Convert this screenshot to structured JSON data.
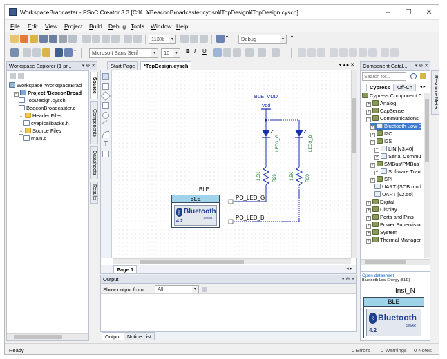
{
  "window": {
    "title": "WorkspaceBradcaster - PSoC Creator 3.3  [C:¥...¥BeaconBroadcaster.cydsn¥TopDesign¥TopDesign.cysch]",
    "minimize": "–",
    "maximize": "☐",
    "close": "✕"
  },
  "menu": [
    "File",
    "Edit",
    "View",
    "Project",
    "Build",
    "Debug",
    "Tools",
    "Window",
    "Help"
  ],
  "toolbar1": {
    "zoom_value": "113%",
    "config_value": "Debug"
  },
  "toolbar2": {
    "font_value": "Microsoft Sans Serif",
    "size_value": "10"
  },
  "workspace_explorer": {
    "title": "Workspace Explorer (1 pr...",
    "controls": "▾ ⊕ ✕",
    "items": [
      {
        "label": "Workspace 'WorkspaceBrad",
        "indent": 0,
        "icon": "ws"
      },
      {
        "label": "Project 'BeaconBroad",
        "indent": 1,
        "icon": "proj",
        "bold": true,
        "expander": "−"
      },
      {
        "label": "TopDesign.cysch",
        "indent": 2,
        "icon": "file"
      },
      {
        "label": "BeaconBroadcaster.c",
        "indent": 2,
        "icon": "file"
      },
      {
        "label": "Header Files",
        "indent": 2,
        "icon": "folder",
        "expander": "−"
      },
      {
        "label": "cyapicallbacks.h",
        "indent": 3,
        "icon": "file"
      },
      {
        "label": "Source Files",
        "indent": 2,
        "icon": "folder",
        "expander": "−"
      },
      {
        "label": "main.c",
        "indent": 3,
        "icon": "file"
      }
    ],
    "side_tabs": [
      "Source",
      "Components",
      "Datasheets",
      "Results"
    ]
  },
  "document": {
    "tabs": [
      {
        "label": "Start Page",
        "active": false
      },
      {
        "label": "*TopDesign.cysch",
        "active": true
      }
    ],
    "tab_controls": "▾ ◂ ▸ ✕",
    "page_tab": "Page 1",
    "schematic": {
      "power_label": "BLE_VDD",
      "vdd_label": "Vdd",
      "led1": "LED3_G",
      "led2": "LED3_B",
      "r1_value": "1.5K",
      "r1_name": "R29",
      "r2_value": "1.5K",
      "r2_name": "R30",
      "ble_instance": "BLE",
      "ble_block_title": "BLE",
      "ble_brand": "Bluetooth",
      "ble_smart": "SMART",
      "ble_version": "4.2",
      "pin1": "PO_LED_G",
      "pin2": "PO_LED_B"
    }
  },
  "output": {
    "title": "Output",
    "controls": "▾ ⊕ ✕",
    "show_from_label": "Show output from:",
    "show_from_value": "All",
    "tabs": [
      "Output",
      "Notice List"
    ]
  },
  "catalog": {
    "title": "Component Catal...",
    "controls": "▾ ⊕ ✕",
    "search_placeholder": "Search for...",
    "tabs": [
      "Cypress",
      "Off-Ch"
    ],
    "items": [
      {
        "label": "Cypress Component Ca",
        "indent": 0,
        "icon": "catfold"
      },
      {
        "label": "Analog",
        "indent": 1,
        "icon": "catfold",
        "expander": "+"
      },
      {
        "label": "CapSense",
        "indent": 1,
        "icon": "catfold",
        "expander": "+"
      },
      {
        "label": "Communications",
        "indent": 1,
        "icon": "catfold",
        "expander": "−"
      },
      {
        "label": "Bluetooth Low E",
        "indent": 2,
        "icon": "comp",
        "expander": "+",
        "selected": true
      },
      {
        "label": "I2C",
        "indent": 2,
        "icon": "catfold",
        "expander": "+"
      },
      {
        "label": "I2S",
        "indent": 2,
        "icon": "catfold",
        "expander": "−"
      },
      {
        "label": "LIN [v3.40]",
        "indent": 3,
        "icon": "comp",
        "expander": "+"
      },
      {
        "label": "Serial Communi",
        "indent": 3,
        "icon": "comp",
        "expander": "+"
      },
      {
        "label": "SMBus/PMBus S",
        "indent": 2,
        "icon": "catfold",
        "expander": "+"
      },
      {
        "label": "Software Transr",
        "indent": 3,
        "icon": "comp",
        "expander": "+"
      },
      {
        "label": "SPI",
        "indent": 2,
        "icon": "catfold",
        "expander": "+"
      },
      {
        "label": "UART (SCB mod",
        "indent": 3,
        "icon": "comp"
      },
      {
        "label": "UART [v2.50]",
        "indent": 3,
        "icon": "comp"
      },
      {
        "label": "Digital",
        "indent": 1,
        "icon": "catfold",
        "expander": "+"
      },
      {
        "label": "Display",
        "indent": 1,
        "icon": "catfold",
        "expander": "+"
      },
      {
        "label": "Ports and Pins",
        "indent": 1,
        "icon": "catfold",
        "expander": "+"
      },
      {
        "label": "Power Supervision",
        "indent": 1,
        "icon": "catfold",
        "expander": "+"
      },
      {
        "label": "System",
        "indent": 1,
        "icon": "catfold",
        "expander": "+"
      },
      {
        "label": "Thermal Managem",
        "indent": 1,
        "icon": "catfold",
        "expander": "+"
      }
    ],
    "side_tab": "Resource Meter",
    "preview": {
      "link": "Open datasheet",
      "desc": "Bluetooth Low Energy (BLE)",
      "instance": "Inst_N",
      "block_title": "BLE",
      "brand": "Bluetooth",
      "smart": "SMART",
      "version": "4.2"
    }
  },
  "status": {
    "left": "Ready",
    "errors": "0 Errors",
    "warnings": "0 Warnings",
    "notes": "0 Notes"
  },
  "colors": {
    "accent": "#1f6fc4",
    "wire_blue": "#1a2fb0",
    "schematic_green": "#1c7a2c",
    "ble_header": "#9fd3ea"
  }
}
